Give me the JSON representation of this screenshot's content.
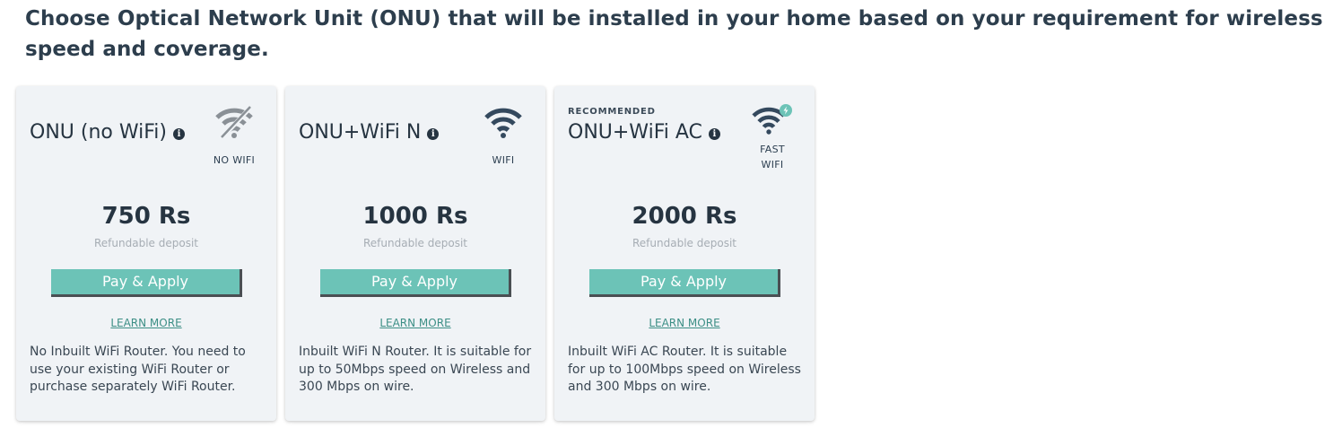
{
  "heading": "Choose Optical Network Unit (ONU) that will be installed in your home based on your requirement for wireless speed and coverage.",
  "cards": [
    {
      "badge": "",
      "title": "ONU (no WiFi)",
      "info_icon": "i",
      "icon": "no-wifi-icon",
      "wifi_label": "NO WIFI",
      "price": "750 Rs",
      "deposit": "Refundable deposit",
      "button": "Pay & Apply",
      "learn_more": "LEARN MORE",
      "description": "No Inbuilt WiFi Router. You need to use your existing WiFi Router or purchase separately WiFi Router."
    },
    {
      "badge": "",
      "title": "ONU+WiFi N",
      "info_icon": "i",
      "icon": "wifi-icon",
      "wifi_label": "WIFI",
      "price": "1000 Rs",
      "deposit": "Refundable deposit",
      "button": "Pay & Apply",
      "learn_more": "LEARN MORE",
      "description": "Inbuilt WiFi N Router. It is suitable for up to 50Mbps speed on Wireless and 300 Mbps on wire."
    },
    {
      "badge": "RECOMMENDED",
      "title": "ONU+WiFi AC",
      "info_icon": "i",
      "icon": "fast-wifi-icon",
      "wifi_label": "FAST WIFI",
      "price": "2000 Rs",
      "deposit": "Refundable deposit",
      "button": "Pay & Apply",
      "learn_more": "LEARN MORE",
      "description": "Inbuilt WiFi AC Router. It is suitable for up to 100Mbps speed on Wireless and 300 Mbps on wire."
    }
  ],
  "colors": {
    "button_bg": "#6cc3b7",
    "card_bg": "#f0f3f6",
    "heading": "#2d3e4d",
    "link": "#3d8f86",
    "wifi_icon": "#34495e",
    "no_wifi_icon": "#8a9096",
    "fast_badge": "#6cc3b7"
  }
}
